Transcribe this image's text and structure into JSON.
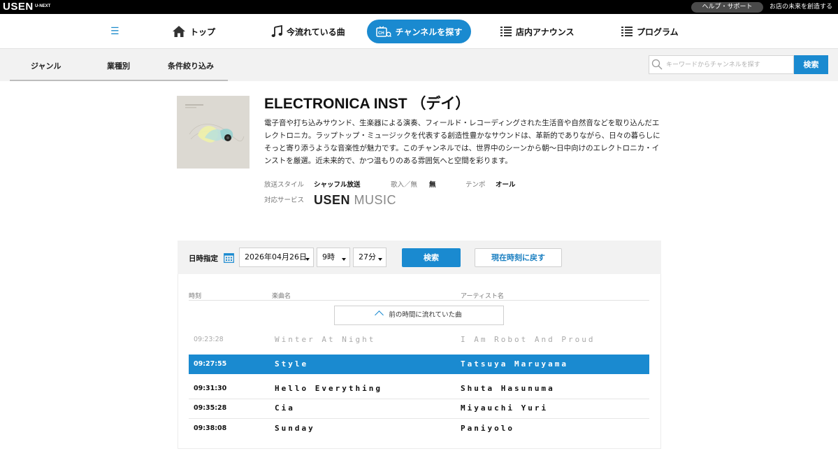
{
  "topbar": {
    "logo": "USEN",
    "logo_sub": "U-NEXT",
    "help_label": "ヘルプ・サポート",
    "future_label": "お店の未来を創造する"
  },
  "mainnav": {
    "menu_icon": "hamburger-icon",
    "items": [
      {
        "label": "トップ",
        "icon": "home-icon"
      },
      {
        "label": "今流れている曲",
        "icon": "music-note-icon"
      },
      {
        "label": "チャンネルを探す",
        "icon": "channel-icon",
        "active": true
      },
      {
        "label": "店内アナウンス",
        "icon": "grid-icon"
      },
      {
        "label": "プログラム",
        "icon": "grid-icon"
      }
    ]
  },
  "subnav": {
    "tabs": [
      "ジャンル",
      "業種別",
      "条件絞り込み"
    ],
    "search_placeholder": "キーワードからチャンネルを探す",
    "search_button": "検索"
  },
  "channel": {
    "title": "ELECTRONICA INST （デイ）",
    "description": "電子音や打ち込みサウンド、生楽器による演奏、フィールド・レコーディングされた生活音や自然音などを取り込んだエレクトロニカ。ラップトップ・ミュージックを代表する創造性豊かなサウンドは、革新的でありながら、日々の暮らしにそっと寄り添うような音楽性が魅力です。このチャンネルでは、世界中のシーンから朝～日中向けのエレクトロニカ・インストを厳選。近未来的で、かつ温もりのある雰囲気へと空間を彩ります。",
    "meta": {
      "style_label": "放送スタイル",
      "style_value": "シャッフル放送",
      "vocal_label": "歌入／無",
      "vocal_value": "無",
      "tempo_label": "テンポ",
      "tempo_value": "オール",
      "service_label": "対応サービス",
      "service_usen": "USEN",
      "service_music": "MUSIC"
    }
  },
  "schedule": {
    "datetime_label": "日時指定",
    "date_value": "2026年04月26日",
    "hour_value": "9時",
    "minute_value": "27分",
    "search_button": "検索",
    "now_button": "現在時刻に戻す",
    "columns": {
      "time": "時刻",
      "title": "楽曲名",
      "artist": "アーティスト名"
    },
    "prev_button": "前の時間に流れていた曲",
    "songs": [
      {
        "time": "09:23:28",
        "title": "Winter At Night",
        "artist": "I Am Robot And Proud",
        "state": "past"
      },
      {
        "time": "09:27:55",
        "title": "Style",
        "artist": "Tatsuya Maruyama",
        "state": "current"
      },
      {
        "time": "09:31:30",
        "title": "Hello Everything",
        "artist": "Shuta Hasunuma",
        "state": "future"
      },
      {
        "time": "09:35:28",
        "title": "Cia",
        "artist": "Miyauchi Yuri",
        "state": "future"
      },
      {
        "time": "09:38:08",
        "title": "Sunday",
        "artist": "Paniyolo",
        "state": "future"
      }
    ]
  },
  "colors": {
    "accent": "#1a8ad0",
    "topbar": "#000000",
    "subnav_bg": "#f2f2f2"
  }
}
